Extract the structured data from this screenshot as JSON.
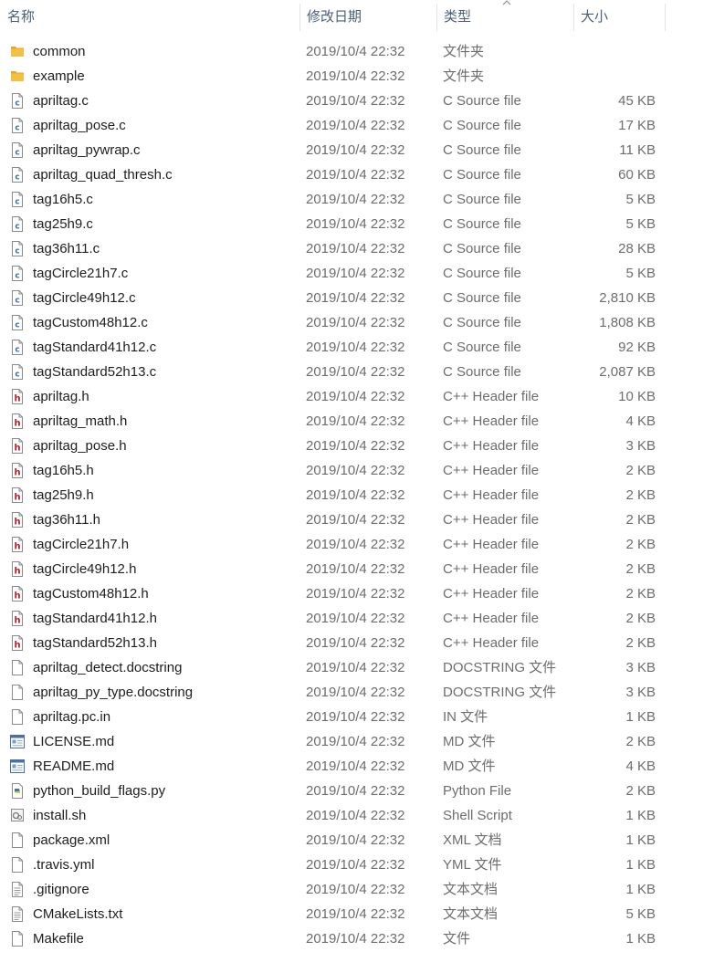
{
  "columns": {
    "name": "名称",
    "date": "修改日期",
    "type": "类型",
    "size": "大小"
  },
  "colors": {
    "header_text": "#4c607a",
    "name_text": "#1e1e1e",
    "detail_text": "#6d6d6d",
    "folder": "#f3c142",
    "c_icon_blue": "#3b6fb6",
    "h_icon_red": "#b3202a"
  },
  "files": [
    {
      "name": "common",
      "date": "2019/10/4 22:32",
      "type": "文件夹",
      "size": "",
      "icon": "folder-icon"
    },
    {
      "name": "example",
      "date": "2019/10/4 22:32",
      "type": "文件夹",
      "size": "",
      "icon": "folder-icon"
    },
    {
      "name": "apriltag.c",
      "date": "2019/10/4 22:32",
      "type": "C Source file",
      "size": "45 KB",
      "icon": "c-source-icon"
    },
    {
      "name": "apriltag_pose.c",
      "date": "2019/10/4 22:32",
      "type": "C Source file",
      "size": "17 KB",
      "icon": "c-source-icon"
    },
    {
      "name": "apriltag_pywrap.c",
      "date": "2019/10/4 22:32",
      "type": "C Source file",
      "size": "11 KB",
      "icon": "c-source-icon"
    },
    {
      "name": "apriltag_quad_thresh.c",
      "date": "2019/10/4 22:32",
      "type": "C Source file",
      "size": "60 KB",
      "icon": "c-source-icon"
    },
    {
      "name": "tag16h5.c",
      "date": "2019/10/4 22:32",
      "type": "C Source file",
      "size": "5 KB",
      "icon": "c-source-icon"
    },
    {
      "name": "tag25h9.c",
      "date": "2019/10/4 22:32",
      "type": "C Source file",
      "size": "5 KB",
      "icon": "c-source-icon"
    },
    {
      "name": "tag36h11.c",
      "date": "2019/10/4 22:32",
      "type": "C Source file",
      "size": "28 KB",
      "icon": "c-source-icon"
    },
    {
      "name": "tagCircle21h7.c",
      "date": "2019/10/4 22:32",
      "type": "C Source file",
      "size": "5 KB",
      "icon": "c-source-icon"
    },
    {
      "name": "tagCircle49h12.c",
      "date": "2019/10/4 22:32",
      "type": "C Source file",
      "size": "2,810 KB",
      "icon": "c-source-icon"
    },
    {
      "name": "tagCustom48h12.c",
      "date": "2019/10/4 22:32",
      "type": "C Source file",
      "size": "1,808 KB",
      "icon": "c-source-icon"
    },
    {
      "name": "tagStandard41h12.c",
      "date": "2019/10/4 22:32",
      "type": "C Source file",
      "size": "92 KB",
      "icon": "c-source-icon"
    },
    {
      "name": "tagStandard52h13.c",
      "date": "2019/10/4 22:32",
      "type": "C Source file",
      "size": "2,087 KB",
      "icon": "c-source-icon"
    },
    {
      "name": "apriltag.h",
      "date": "2019/10/4 22:32",
      "type": "C++ Header file",
      "size": "10 KB",
      "icon": "h-header-icon"
    },
    {
      "name": "apriltag_math.h",
      "date": "2019/10/4 22:32",
      "type": "C++ Header file",
      "size": "4 KB",
      "icon": "h-header-icon"
    },
    {
      "name": "apriltag_pose.h",
      "date": "2019/10/4 22:32",
      "type": "C++ Header file",
      "size": "3 KB",
      "icon": "h-header-icon"
    },
    {
      "name": "tag16h5.h",
      "date": "2019/10/4 22:32",
      "type": "C++ Header file",
      "size": "2 KB",
      "icon": "h-header-icon"
    },
    {
      "name": "tag25h9.h",
      "date": "2019/10/4 22:32",
      "type": "C++ Header file",
      "size": "2 KB",
      "icon": "h-header-icon"
    },
    {
      "name": "tag36h11.h",
      "date": "2019/10/4 22:32",
      "type": "C++ Header file",
      "size": "2 KB",
      "icon": "h-header-icon"
    },
    {
      "name": "tagCircle21h7.h",
      "date": "2019/10/4 22:32",
      "type": "C++ Header file",
      "size": "2 KB",
      "icon": "h-header-icon"
    },
    {
      "name": "tagCircle49h12.h",
      "date": "2019/10/4 22:32",
      "type": "C++ Header file",
      "size": "2 KB",
      "icon": "h-header-icon"
    },
    {
      "name": "tagCustom48h12.h",
      "date": "2019/10/4 22:32",
      "type": "C++ Header file",
      "size": "2 KB",
      "icon": "h-header-icon"
    },
    {
      "name": "tagStandard41h12.h",
      "date": "2019/10/4 22:32",
      "type": "C++ Header file",
      "size": "2 KB",
      "icon": "h-header-icon"
    },
    {
      "name": "tagStandard52h13.h",
      "date": "2019/10/4 22:32",
      "type": "C++ Header file",
      "size": "2 KB",
      "icon": "h-header-icon"
    },
    {
      "name": "apriltag_detect.docstring",
      "date": "2019/10/4 22:32",
      "type": "DOCSTRING 文件",
      "size": "3 KB",
      "icon": "blank-file-icon"
    },
    {
      "name": "apriltag_py_type.docstring",
      "date": "2019/10/4 22:32",
      "type": "DOCSTRING 文件",
      "size": "3 KB",
      "icon": "blank-file-icon"
    },
    {
      "name": "apriltag.pc.in",
      "date": "2019/10/4 22:32",
      "type": "IN 文件",
      "size": "1 KB",
      "icon": "blank-file-icon"
    },
    {
      "name": "LICENSE.md",
      "date": "2019/10/4 22:32",
      "type": "MD 文件",
      "size": "2 KB",
      "icon": "markdown-file-icon"
    },
    {
      "name": "README.md",
      "date": "2019/10/4 22:32",
      "type": "MD 文件",
      "size": "4 KB",
      "icon": "markdown-file-icon"
    },
    {
      "name": "python_build_flags.py",
      "date": "2019/10/4 22:32",
      "type": "Python File",
      "size": "2 KB",
      "icon": "python-file-icon"
    },
    {
      "name": "install.sh",
      "date": "2019/10/4 22:32",
      "type": "Shell Script",
      "size": "1 KB",
      "icon": "shell-script-icon"
    },
    {
      "name": "package.xml",
      "date": "2019/10/4 22:32",
      "type": "XML 文档",
      "size": "1 KB",
      "icon": "blank-file-icon"
    },
    {
      "name": ".travis.yml",
      "date": "2019/10/4 22:32",
      "type": "YML 文件",
      "size": "1 KB",
      "icon": "blank-file-icon"
    },
    {
      "name": ".gitignore",
      "date": "2019/10/4 22:32",
      "type": "文本文档",
      "size": "1 KB",
      "icon": "text-file-icon"
    },
    {
      "name": "CMakeLists.txt",
      "date": "2019/10/4 22:32",
      "type": "文本文档",
      "size": "5 KB",
      "icon": "text-file-icon"
    },
    {
      "name": "Makefile",
      "date": "2019/10/4 22:32",
      "type": "文件",
      "size": "1 KB",
      "icon": "blank-file-icon"
    }
  ]
}
